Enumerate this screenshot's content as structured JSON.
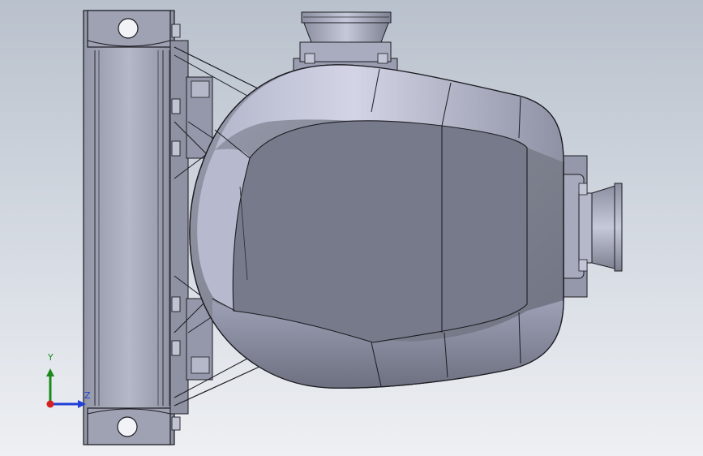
{
  "viewport": {
    "background_top": "#b9c1cc",
    "background_bottom": "#eef0f3"
  },
  "triad": {
    "y_label": "Y",
    "z_label": "Z",
    "y_color": "#1a8a1a",
    "z_color": "#1f3fd8",
    "x_color": "#d42020"
  },
  "model": {
    "body_color": "#7a7d8e",
    "highlight_color": "#c8cbe0",
    "edge_color": "#1c1c22"
  }
}
